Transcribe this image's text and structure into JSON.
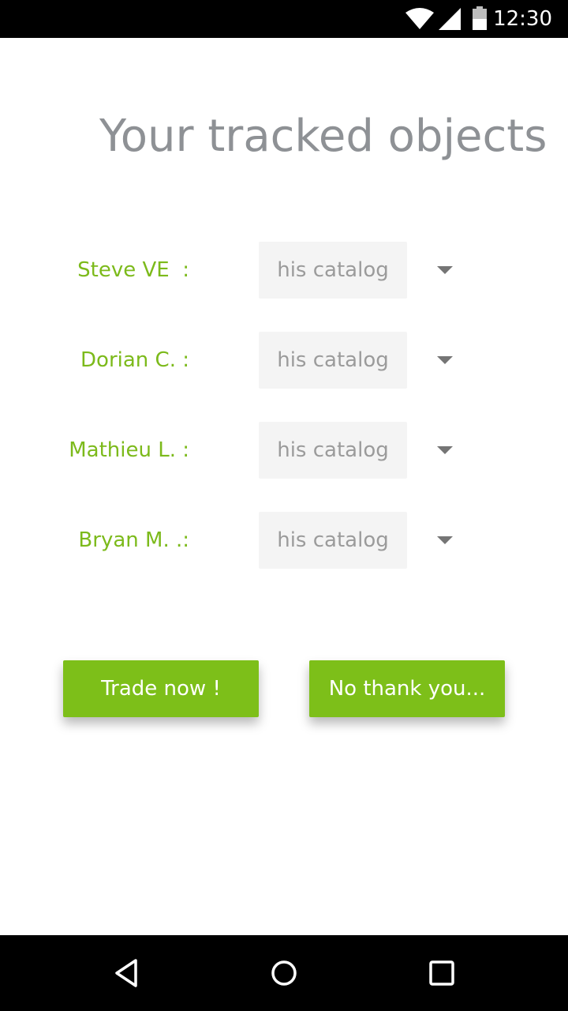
{
  "status_bar": {
    "time": "12:30",
    "icons": [
      "wifi-icon",
      "signal-icon",
      "battery-icon"
    ]
  },
  "title": "Your tracked objects",
  "rows": [
    {
      "label": "Steve VE  :",
      "select_value": "his catalog"
    },
    {
      "label": "Dorian C. :",
      "select_value": "his catalog"
    },
    {
      "label": "Mathieu L. :",
      "select_value": "his catalog"
    },
    {
      "label": "Bryan M. .:",
      "select_value": "his catalog"
    }
  ],
  "buttons": {
    "trade": "Trade now !",
    "decline": "No thank you..."
  },
  "nav_bar": {
    "icons": [
      "back-icon",
      "home-icon",
      "recent-apps-icon"
    ]
  },
  "colors": {
    "accent": "#7dbf19",
    "label_green": "#7cba1b",
    "title_gray": "#8e9195",
    "select_bg": "#f4f4f4"
  }
}
